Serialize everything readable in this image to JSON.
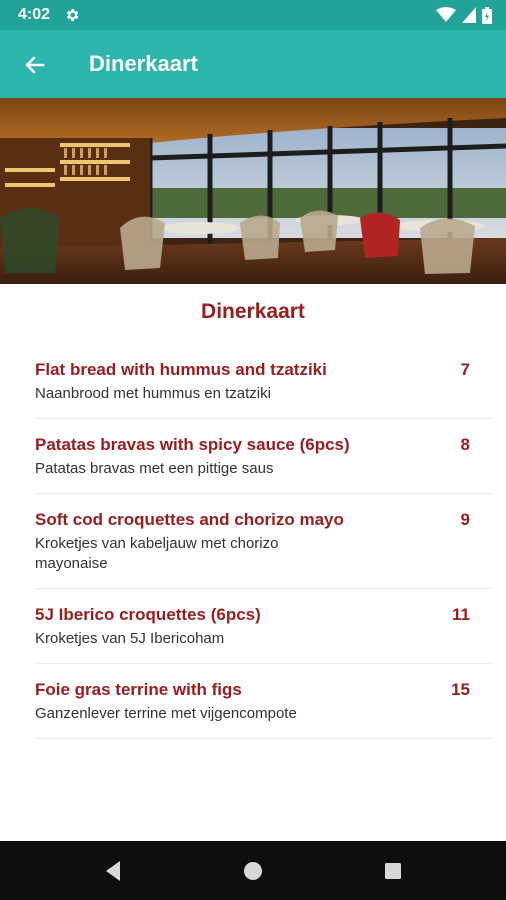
{
  "status_bar": {
    "time": "4:02",
    "icons": [
      "settings-icon",
      "wifi-icon",
      "signal-icon",
      "battery-icon"
    ]
  },
  "app_bar": {
    "back_icon": "arrow-back-icon",
    "title": "Dinerkaart"
  },
  "hero_image": {
    "subject": "restaurant interior with tables, chairs and bar"
  },
  "section": {
    "title": "Dinerkaart"
  },
  "menu": [
    {
      "name": "Flat bread with hummus and tzatziki",
      "description": "Naanbrood met hummus en tzatziki",
      "price": "7"
    },
    {
      "name": "Patatas bravas with spicy sauce (6pcs)",
      "description": "Patatas bravas met een pittige saus",
      "price": "8"
    },
    {
      "name": "Soft cod croquettes and chorizo mayo",
      "description": "Kroketjes van kabeljauw met chorizo mayonaise",
      "price": "9"
    },
    {
      "name": "5J Iberico croquettes (6pcs)",
      "description": "Kroketjes van 5J Ibericoham",
      "price": "11"
    },
    {
      "name": "Foie gras terrine with figs",
      "description": "Ganzenlever terrine met vijgencompote",
      "price": "15"
    }
  ],
  "nav_bar": {
    "icons": [
      "back-triangle-icon",
      "home-circle-icon",
      "recents-square-icon"
    ]
  },
  "colors": {
    "status_bar": "#21a39a",
    "app_bar": "#2cb6ad",
    "accent": "#9b1c1f",
    "nav_bar": "#0e0e0e"
  }
}
